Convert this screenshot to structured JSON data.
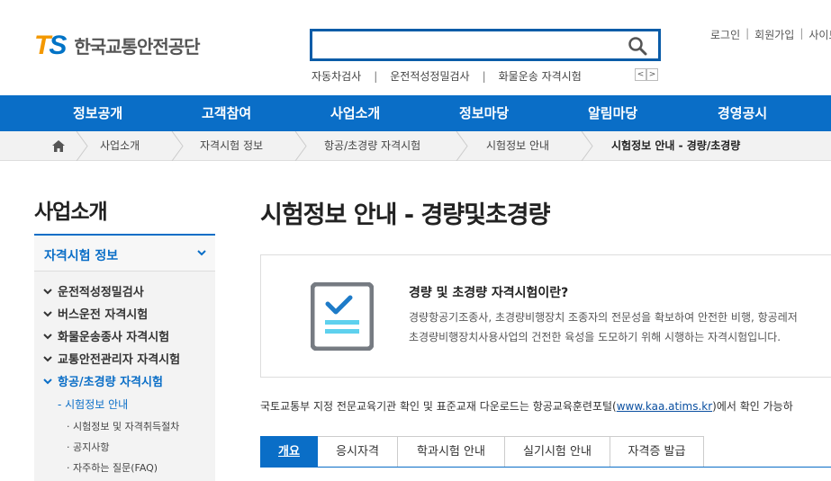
{
  "header": {
    "logo_ts_t": "T",
    "logo_ts_s": "S",
    "logo_name": "한국교통안전공단",
    "search": {
      "value": "",
      "placeholder": ""
    },
    "quick_links": [
      "자동차검사",
      "운전적성정밀검사",
      "화물운송 자격시험"
    ],
    "quick_sep": "|",
    "arrow_prev": "<",
    "arrow_next": ">",
    "util_links": [
      "로그인",
      "회원가입",
      "사이트맵"
    ],
    "util_sep": "|"
  },
  "gnb": [
    "정보공개",
    "고객참여",
    "사업소개",
    "정보마당",
    "알림마당",
    "경영공시"
  ],
  "breadcrumb": [
    "사업소개",
    "자격시험 정보",
    "항공/초경량 자격시험",
    "시험정보 안내",
    "시험정보 안내 - 경량/초경량"
  ],
  "lnb": {
    "title": "사업소개",
    "head": "자격시험 정보",
    "items": [
      "운전적성정밀검사",
      "버스운전 자격시험",
      "화물운송종사 자격시험",
      "교통안전관리자 자격시험",
      "항공/초경량 자격시험"
    ],
    "sub": "- 시험정보 안내",
    "sub2": [
      "· 시험정보 및 자격취득절차",
      "· 공지사항",
      "· 자주하는 질문(FAQ)"
    ]
  },
  "main": {
    "title": "시험정보 안내 - 경량및초경량",
    "intro_heading": "경량 및 초경량 자격시험이란?",
    "intro_line1": "경량항공기조종사, 초경량비행장치 조종자의 전문성을 확보하여 안전한 비행, 항공레저",
    "intro_line2": "초경량비행장치사용사업의 건전한 육성을 도모하기 위해 시행하는 자격시험입니다.",
    "notice_prefix": "국토교통부 지정 전문교육기관 확인 및 표준교재 다운로드는 항공교육훈련포털(",
    "notice_link": "www.kaa.atims.kr",
    "notice_suffix": ")에서 확인 가능하",
    "tabs": [
      "개요",
      "응시자격",
      "학과시험 안내",
      "실기시험 안내",
      "자격증 발급"
    ]
  },
  "colors": {
    "brand_blue": "#0a6ec7",
    "brand_orange": "#f39800"
  }
}
